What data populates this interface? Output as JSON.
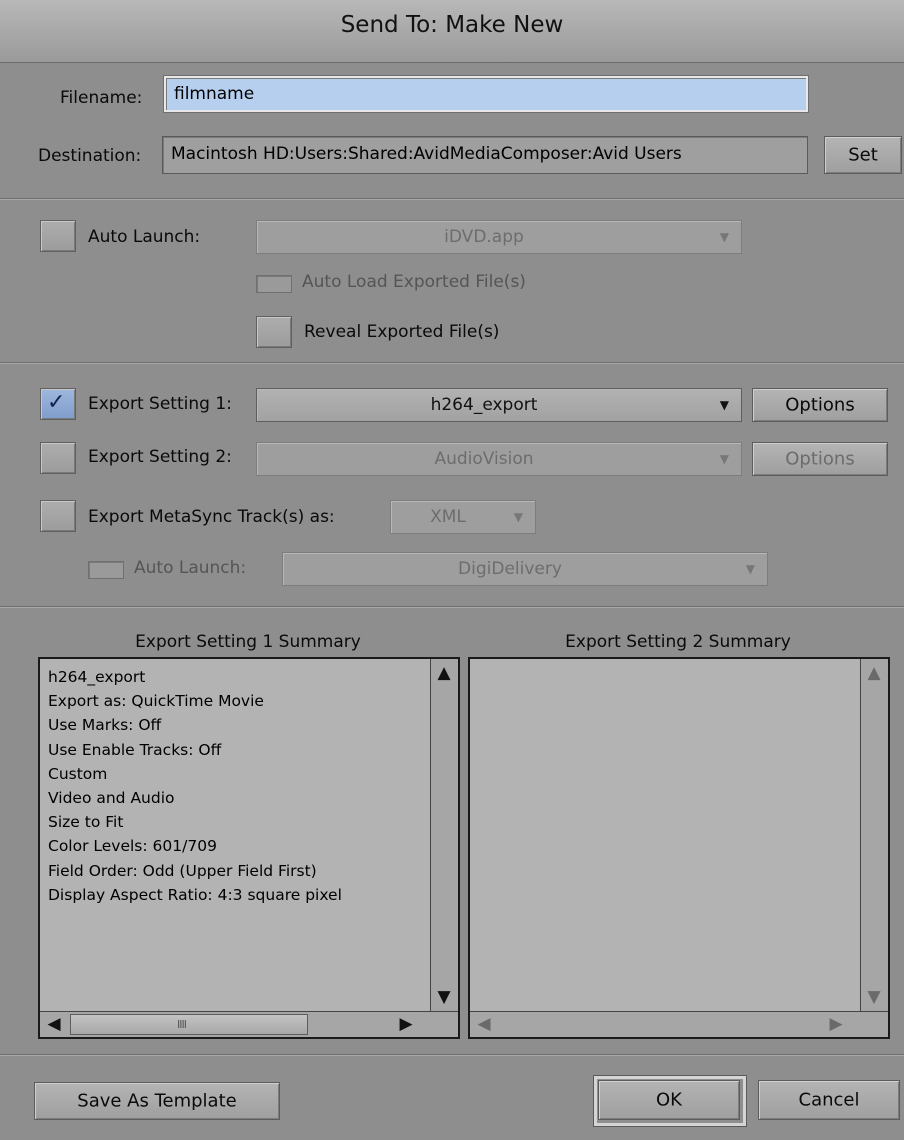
{
  "window": {
    "title": "Send To: Make New"
  },
  "file": {
    "filename_label": "Filename:",
    "filename_value": "filmname",
    "destination_label": "Destination:",
    "destination_value": "Macintosh HD:Users:Shared:AvidMediaComposer:Avid Users",
    "set_button": "Set"
  },
  "launch": {
    "auto_launch_label": "Auto Launch:",
    "auto_launch_app": "iDVD.app",
    "auto_load_label": "Auto Load Exported File(s)",
    "reveal_label": "Reveal Exported File(s)"
  },
  "export": {
    "setting1_label": "Export Setting 1:",
    "setting1_value": "h264_export",
    "setting1_checked": true,
    "setting1_options": "Options",
    "setting2_label": "Export Setting 2:",
    "setting2_value": "AudioVision",
    "setting2_options": "Options",
    "metasync_label": "Export MetaSync Track(s) as:",
    "metasync_value": "XML",
    "sub_auto_launch_label": "Auto Launch:",
    "sub_auto_launch_value": "DigiDelivery"
  },
  "summary1": {
    "title": "Export Setting 1 Summary",
    "lines": [
      "h264_export",
      "Export as: QuickTime Movie",
      "Use Marks: Off",
      "Use Enable Tracks: Off",
      "Custom",
      "Video and Audio",
      "Size to Fit",
      "Color Levels: 601/709",
      "Field Order: Odd (Upper Field First)",
      "Display Aspect Ratio: 4:3 square pixel"
    ]
  },
  "summary2": {
    "title": "Export Setting 2 Summary",
    "lines": []
  },
  "footer": {
    "save_template": "Save As Template",
    "ok": "OK",
    "cancel": "Cancel"
  },
  "colors": {
    "dialog_bg": "#8e8e8e",
    "filename_highlight": "#b7cfee",
    "checkbox_checked": "#8aa6d3"
  },
  "icons": {
    "check": "checkmark-icon",
    "dropdown": "chevron-down-icon",
    "scroll_up": "arrow-up-icon",
    "scroll_down": "arrow-down-icon",
    "scroll_left": "arrow-left-icon",
    "scroll_right": "arrow-right-icon"
  }
}
